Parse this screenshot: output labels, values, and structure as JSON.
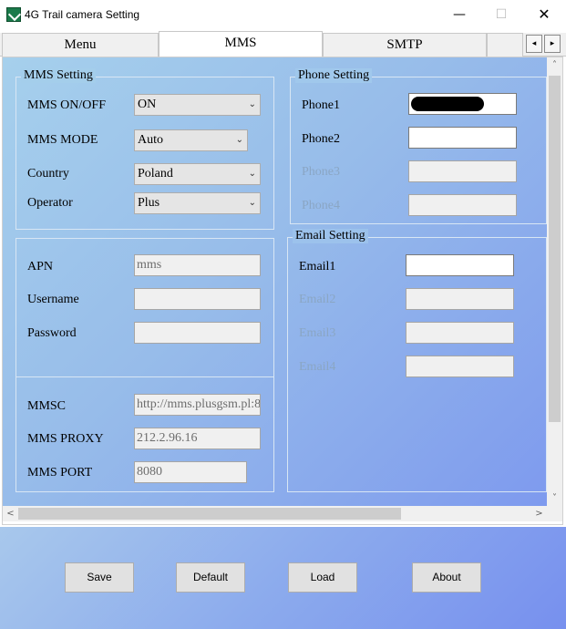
{
  "window": {
    "title": "4G Trail camera Setting",
    "minimize": "—",
    "maximize": "☐",
    "close": "✕"
  },
  "tabs": {
    "menu": "Menu",
    "mms": "MMS",
    "smtp": "SMTP",
    "left_arrow": "◂",
    "right_arrow": "▸"
  },
  "mms_setting": {
    "legend": "MMS Setting",
    "onoff_label": "MMS ON/OFF",
    "onoff_value": "ON",
    "mode_label": "MMS MODE",
    "mode_value": "Auto",
    "country_label": "Country",
    "country_value": "Poland",
    "operator_label": "Operator",
    "operator_value": "Plus"
  },
  "apn_group": {
    "apn_label": "APN",
    "apn_value": "mms",
    "username_label": "Username",
    "username_value": "",
    "password_label": "Password",
    "password_value": ""
  },
  "mmsc_group": {
    "mmsc_label": "MMSC",
    "mmsc_value": "http://mms.plusgsm.pl:8",
    "proxy_label": "MMS PROXY",
    "proxy_value": " 212.2.96.16",
    "port_label": "MMS PORT",
    "port_value": "8080"
  },
  "phone_setting": {
    "legend": "Phone Setting",
    "phone1": "Phone1",
    "phone2": "Phone2",
    "phone3": "Phone3",
    "phone4": "Phone4"
  },
  "email_setting": {
    "legend": "Email Setting",
    "email1": "Email1",
    "email2": "Email2",
    "email3": "Email3",
    "email4": "Email4"
  },
  "scroll": {
    "up": "˄",
    "down": "˅",
    "left": "<",
    "right": ">"
  },
  "buttons": {
    "save": "Save",
    "default": "Default",
    "load": "Load",
    "about": "About"
  }
}
